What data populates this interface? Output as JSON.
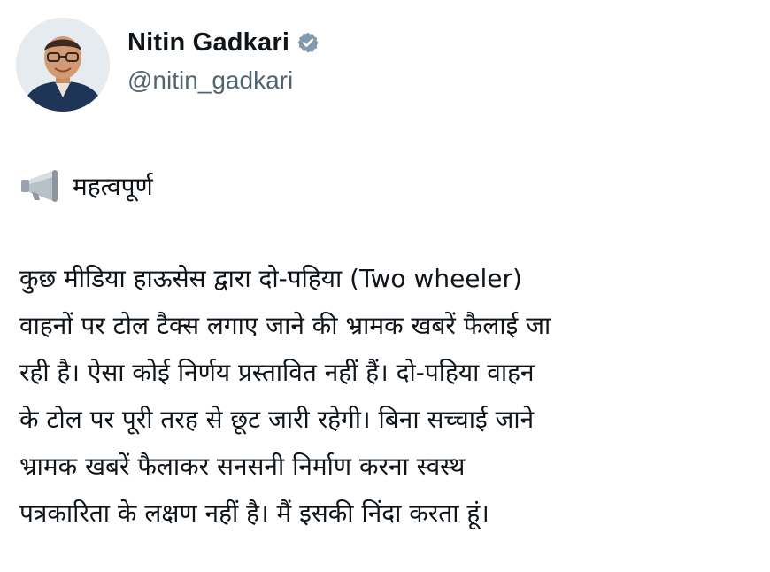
{
  "author": {
    "display_name": "Nitin Gadkari",
    "handle": "@nitin_gadkari",
    "verified_icon": "verified-badge-icon",
    "verified_color": "#829aab"
  },
  "tweet": {
    "heading_icon": "megaphone-icon",
    "heading": "महत्वपूर्ण",
    "lines": [
      "कुछ मीडिया हाऊसेस  द्वारा दो-पहिया (Two wheeler)",
      "वाहनों पर टोल टैक्स लगाए जाने की भ्रामक खबरें फैलाई जा",
      "रही है। ऐसा कोई निर्णय प्रस्तावित नहीं हैं। दो-पहिया वाहन",
      "के टोल पर पूरी तरह से छूट जारी रहेगी। बिना सच्चाई जाने",
      "भ्रामक खबरें फैलाकर सनसनी निर्माण करना स्वस्थ",
      "पत्रकारिता के लक्षण नहीं है। मैं इसकी निंदा करता हूं।"
    ]
  }
}
